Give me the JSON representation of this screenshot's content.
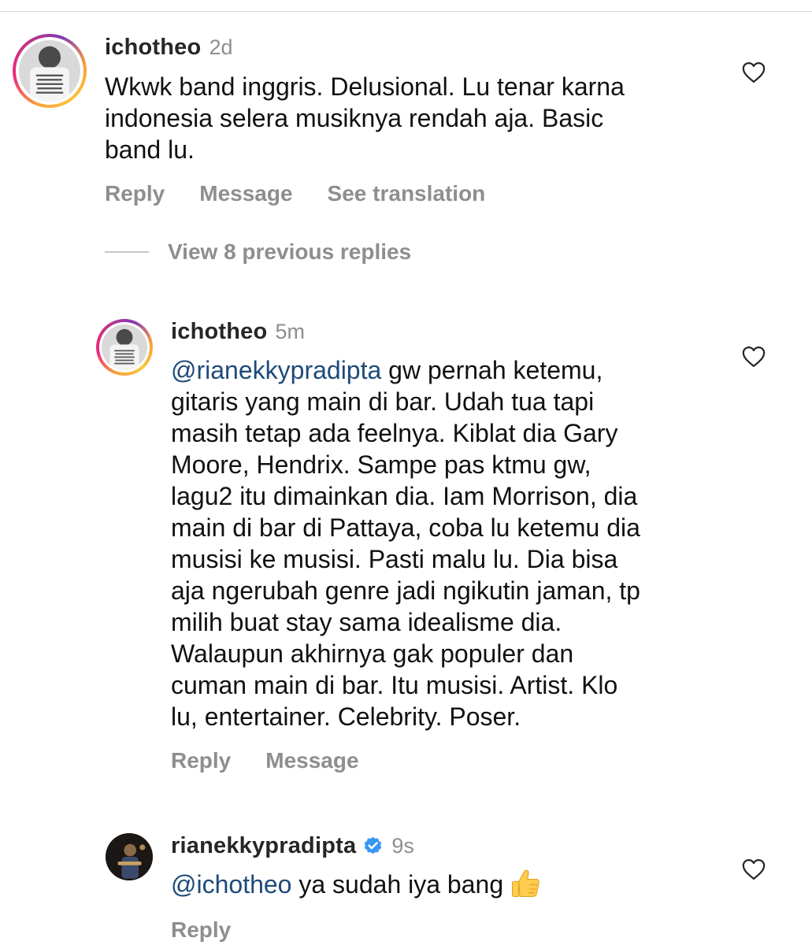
{
  "comments": [
    {
      "username": "ichotheo",
      "time": "2d",
      "text": "Wkwk band inggris. Delusional. Lu tenar karna\nindonesia selera musiknya rendah aja. Basic\nband lu.",
      "actions": [
        "Reply",
        "Message",
        "See translation"
      ],
      "avatar_icon": "profile-photo-icon",
      "like_icon": "heart-outline-icon"
    }
  ],
  "view_replies_label": "View 8 previous replies",
  "replies": [
    {
      "username": "ichotheo",
      "time": "5m",
      "mention": "@rianekkypradipta",
      "text": " gw pernah ketemu,\ngitaris yang main di bar. Udah tua tapi\nmasih tetap ada feelnya. Kiblat dia Gary\nMoore, Hendrix. Sampe pas ktmu gw,\nlagu2 itu dimainkan dia. Iam Morrison, dia\nmain di bar di Pattaya, coba lu ketemu dia\nmusisi ke musisi. Pasti malu lu. Dia bisa\naja ngerubah genre jadi ngikutin jaman, tp\nmilih buat stay sama idealisme dia.\nWalaupun akhirnya gak populer dan\ncuman main di bar. Itu musisi. Artist. Klo\nlu, entertainer. Celebrity. Poser.",
      "actions": [
        "Reply",
        "Message"
      ]
    },
    {
      "username": "rianekkypradipta",
      "verified": true,
      "time": "9s",
      "mention": "@ichotheo",
      "text": " ya sudah iya bang",
      "emoji": "thumbs-up-emoji",
      "actions": [
        "Reply"
      ]
    }
  ],
  "colors": {
    "mention": "#1e4a7a",
    "muted": "#8e8e8e",
    "verified": "#3897f0"
  }
}
